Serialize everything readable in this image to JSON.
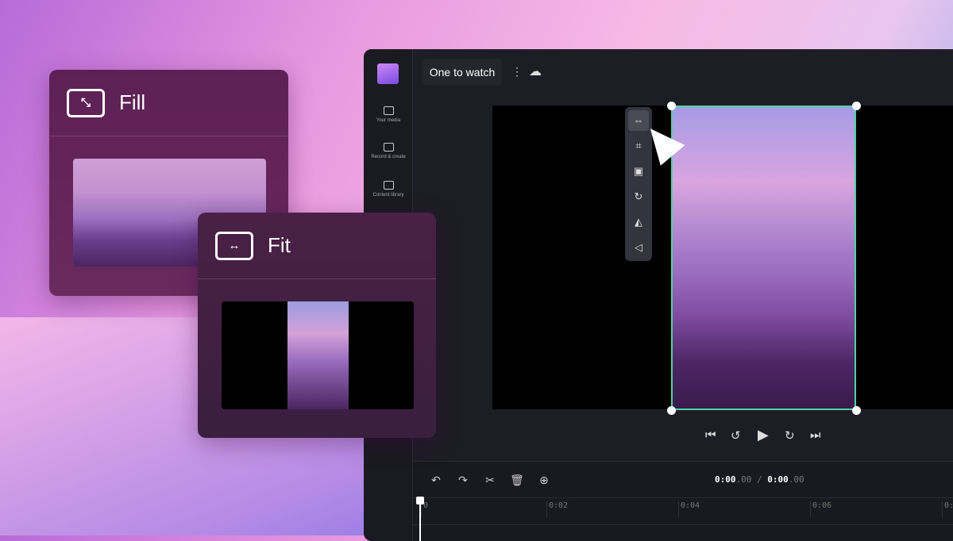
{
  "project": {
    "title": "One to watch"
  },
  "sidebar": {
    "items": [
      {
        "label": "Your media",
        "icon": "folder-icon"
      },
      {
        "label": "Record & create",
        "icon": "camera-icon"
      },
      {
        "label": "Content library",
        "icon": "library-icon"
      }
    ]
  },
  "preview_tools": [
    "fit-icon",
    "crop-icon",
    "picture-in-picture-icon",
    "rotate-icon",
    "flip-icon",
    "flip-vertical-icon"
  ],
  "playback": [
    "skip-back-icon",
    "rewind-5-icon",
    "play-icon",
    "forward-5-icon",
    "skip-forward-icon"
  ],
  "timeline": {
    "current": "0:00",
    "current_frac": ".00",
    "sep": " / ",
    "total": "0:00",
    "total_frac": ".00",
    "ticks": [
      "0",
      "0:02",
      "0:04",
      "0:06",
      "0:"
    ]
  },
  "cards": {
    "fill": "Fill",
    "fit": "Fit"
  },
  "colors": {
    "selection": "#4fd3a6",
    "card": "#5d2055"
  }
}
